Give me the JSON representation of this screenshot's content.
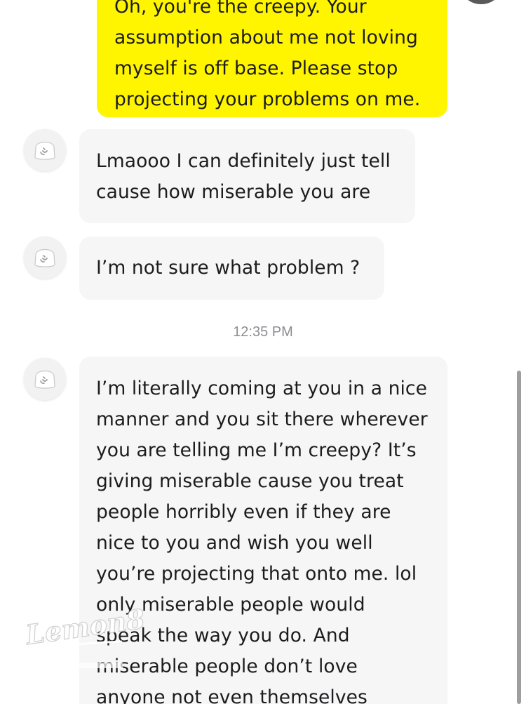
{
  "messages": [
    {
      "sender": "me",
      "lines": [
        "Oh, you're the creepy. Your",
        "assumption about me not loving",
        "myself is off base. Please stop",
        "projecting your problems on me."
      ]
    },
    {
      "sender": "them",
      "lines": [
        "Lmaooo I can definitely just tell",
        "cause how miserable you are"
      ]
    },
    {
      "sender": "them",
      "lines": [
        "I’m not sure what problem ?"
      ]
    },
    {
      "sender": "them",
      "lines": [
        "I’m literally coming at you in a nice",
        "manner and you sit there wherever",
        "you are telling me I’m creepy? It’s",
        "giving miserable cause you treat",
        "people horribly even if they are",
        "nice to you and wish you well",
        "you’re projecting that onto me. lol",
        "only miserable people would",
        "speak the way you do. And",
        "miserable people don’t love",
        "anyone not even themselves"
      ]
    }
  ],
  "timestamp": "12:35 PM",
  "watermark": {
    "text": "Lemon8"
  },
  "colors": {
    "sent_bubble": "#fff500",
    "received_bubble": "#f6f6f6",
    "text": "#1c1c1e",
    "timestamp": "#8e8e93"
  },
  "icons": {
    "contact_avatar": "bitmoji-ghost-avatar-icon",
    "self_avatar": "profile-avatar-icon"
  }
}
